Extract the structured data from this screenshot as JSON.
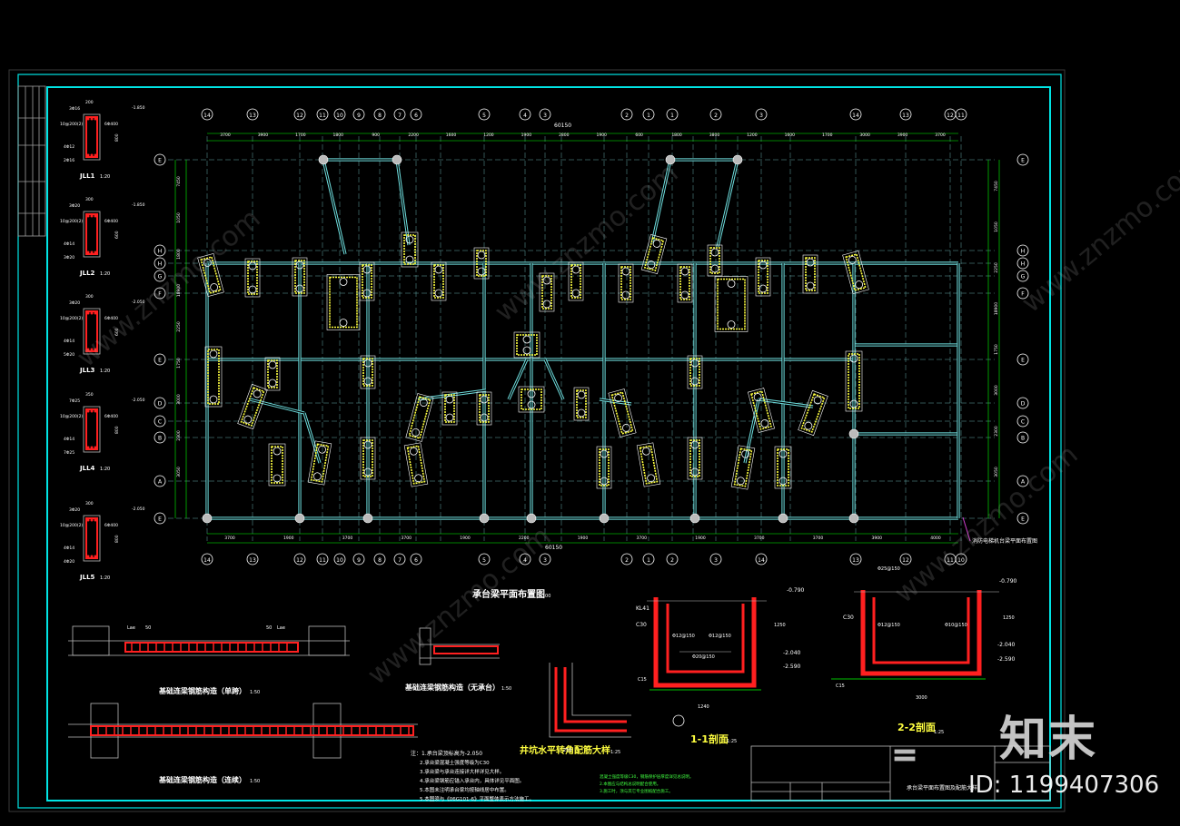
{
  "colors": {
    "frame": "#00e5e5",
    "axis": "#7fd0d0",
    "beam": "#6fe0e0",
    "pile": "#ffff40",
    "rebar": "#ff2020",
    "text": "#ffffff",
    "green": "#40ff40",
    "grey": "#a0a0a0"
  },
  "watermark": {
    "logo": "知末",
    "id": "ID: 1199407306",
    "diagonal": "www.znzmo.com"
  },
  "plan": {
    "title": "承台梁平面布置图",
    "scale": "1:100",
    "top_axis_labels": [
      "14",
      "13",
      "12",
      "11",
      "10",
      "9",
      "8",
      "7",
      "6",
      "5",
      "4",
      "3",
      "2",
      "1",
      "1",
      "2",
      "3"
    ],
    "bottom_axis_labels": [
      "14",
      "13",
      "12",
      "11",
      "10",
      "9",
      "8",
      "7",
      "6",
      "5",
      "4",
      "3",
      "2",
      "1",
      "2",
      "3"
    ],
    "left_axis_labels": [
      "E",
      "H",
      "H",
      "G",
      "F",
      "E",
      "D",
      "C",
      "B",
      "A"
    ],
    "right_axis_labels": [
      "E",
      "H",
      "H",
      "G",
      "F",
      "E",
      "D",
      "C",
      "B",
      "A"
    ],
    "top_dims": [
      "3700",
      "3900",
      "1700",
      "1800",
      "900",
      "2200",
      "1600",
      "1200",
      "1900",
      "2800",
      "1900",
      "600",
      "1800",
      "3800",
      "1200",
      "1600",
      "1700",
      "3000",
      "3900",
      "3700"
    ],
    "bottom_dims": [
      "3700",
      "1900",
      "3700",
      "3700",
      "1900",
      "2200",
      "1900",
      "3700",
      "1900",
      "3700",
      "3700",
      "3900",
      "4000"
    ],
    "total_dim": "60150",
    "left_dims": [
      "7450",
      "1050",
      "1800",
      "18900",
      "2250",
      "1750",
      "3000",
      "2300",
      "3050"
    ],
    "right_dims": [
      "7450",
      "1050",
      "2250",
      "18900",
      "1750",
      "3000",
      "2300",
      "3050"
    ],
    "note_right": "消防电梯机台梁平面布置图"
  },
  "beam_sections": [
    {
      "name": "JLL1",
      "scale": "1:20",
      "top": "3Φ16",
      "stirrup": "10@200(2)",
      "mid": "6Φ400",
      "bottom": "4Φ12",
      "bot2": "2Φ16",
      "width": "200",
      "height": "800",
      "level": "-1.850"
    },
    {
      "name": "JLL2",
      "scale": "1:20",
      "top": "3Φ20",
      "stirrup": "10@200(2)",
      "mid": "6Φ400",
      "bottom": "4Φ14",
      "bot2": "3Φ20",
      "width": "300",
      "height": "600",
      "level": "-1.850"
    },
    {
      "name": "JLL3",
      "scale": "1:20",
      "top": "3Φ20",
      "stirrup": "10@200(2)",
      "mid": "6Φ400",
      "bottom": "4Φ14",
      "bot2": "5Φ20",
      "width": "300",
      "height": "600",
      "level": "-2.050"
    },
    {
      "name": "JLL4",
      "scale": "1:20",
      "top": "7Φ25",
      "stirrup": "10@200(2)",
      "mid": "6Φ400",
      "bottom": "4Φ14",
      "bot2": "7Φ25",
      "width": "350",
      "height": "800",
      "level": "-2.050"
    },
    {
      "name": "JLL5",
      "scale": "1:20",
      "top": "3Φ20",
      "stirrup": "10@200(2)",
      "mid": "6Φ400",
      "bottom": "4Φ14",
      "bot2": "4Φ20",
      "width": "300",
      "height": "800",
      "level": "-2.050"
    }
  ],
  "details": {
    "single_span": "基础连梁钢筋构造（单跨）",
    "single_scale": "1:50",
    "continuous": "基础连梁钢筋构造（连续）",
    "continuous_scale": "1:50",
    "no_cap": "基础连梁钢筋构造（无承台）",
    "no_cap_scale": "1:50",
    "pit_corner": "井坑水平转角配筋大样",
    "pit_scale": "1:25",
    "section11": "1-1剖面",
    "section11_scale": "1:25",
    "section22": "2-2剖面",
    "section22_scale": "1:25",
    "lae": "Lae",
    "dim50": "50",
    "lvl_0790": "-0.790",
    "lvl_2040": "-2.040",
    "lvl_2590": "-2.590",
    "c30": "C30",
    "c15": "C15",
    "kl41": "KL41",
    "d240": "1240",
    "d100": "100",
    "d3000": "3000",
    "d1250": "1250",
    "d250": "250",
    "rebar_a": "Φ8@200",
    "rebar_b": "Φ12@150",
    "rebar_c": "Φ25@150",
    "rebar_d": "Φ20@150",
    "rebar_e": "Φ10@150"
  },
  "notes": [
    "注：1.承台梁顶标高为-2.050",
    "2.承台梁混凝土强度等级为C30",
    "3.承台梁与承台连接详大样详见大样。",
    "4.承台梁钢筋应锚入承台内，具体详见平面图。",
    "5.本图未注明承台梁均按轴线居中布置。",
    "5.本图须与《06G101-6》平面整体表示方法施工。"
  ],
  "notes_green": [
    "混凝土强度等级C30，钢筋保护层厚度详见总说明。",
    "2.本图应与结构总说明配合使用。",
    "3.施工时，须与其它专业图纸配合施工。"
  ],
  "title_block": {
    "drawing_title": "承台梁平面布置图及配筋大样",
    "cell_a": "",
    "cell_b": ""
  }
}
